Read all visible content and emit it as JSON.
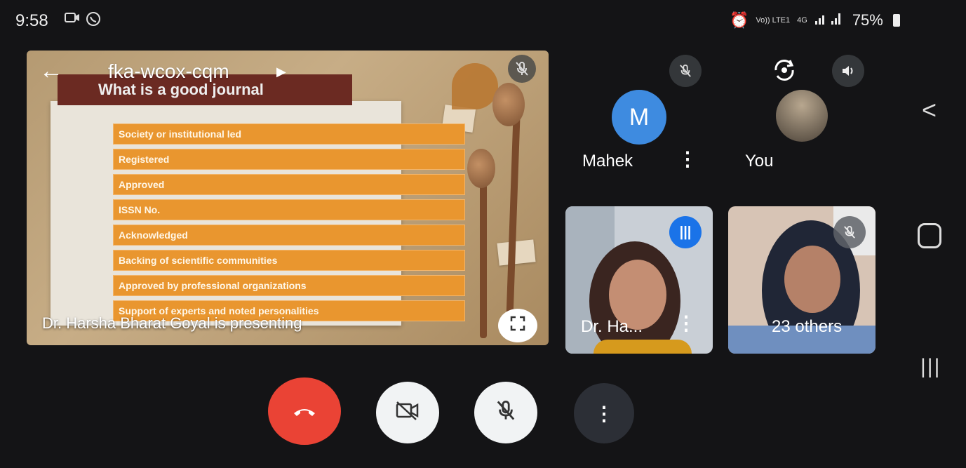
{
  "status_bar": {
    "time": "9:58",
    "left_icons": [
      "video-icon",
      "whatsapp-icon"
    ],
    "alarm_icon": "alarm-icon",
    "volte_label": "Vo)) LTE1",
    "network_label": "4G",
    "battery": "75%"
  },
  "presentation": {
    "meeting_code": "fka-wcox-cqm",
    "slide_title": "What is a good journal",
    "bullets": [
      "Society or institutional led",
      "Registered",
      "Approved",
      "ISSN No.",
      "Acknowledged",
      "Backing of scientific communities",
      "Approved by professional organizations",
      "Support of experts and noted personalities"
    ],
    "presenting_text": "Dr. Harsha Bharat Goyal is presenting",
    "fullscreen_icon": "fullscreen-icon"
  },
  "participants": {
    "mahek": {
      "initial": "M",
      "name": "Mahek"
    },
    "you": {
      "name": "You"
    },
    "harsha": {
      "name": "Dr. Ha..."
    },
    "others": {
      "label": "23 others"
    }
  },
  "controls": {
    "end_call_icon": "end-call-icon",
    "camera_icon": "camera-off-icon",
    "mic_icon": "mic-off-icon",
    "more_icon": "more-vert-icon"
  },
  "colors": {
    "end_call": "#ea4335",
    "accent_blue": "#1a73e8",
    "slide_bullet": "#e9962f",
    "slide_title_bg": "#6b2a22"
  }
}
